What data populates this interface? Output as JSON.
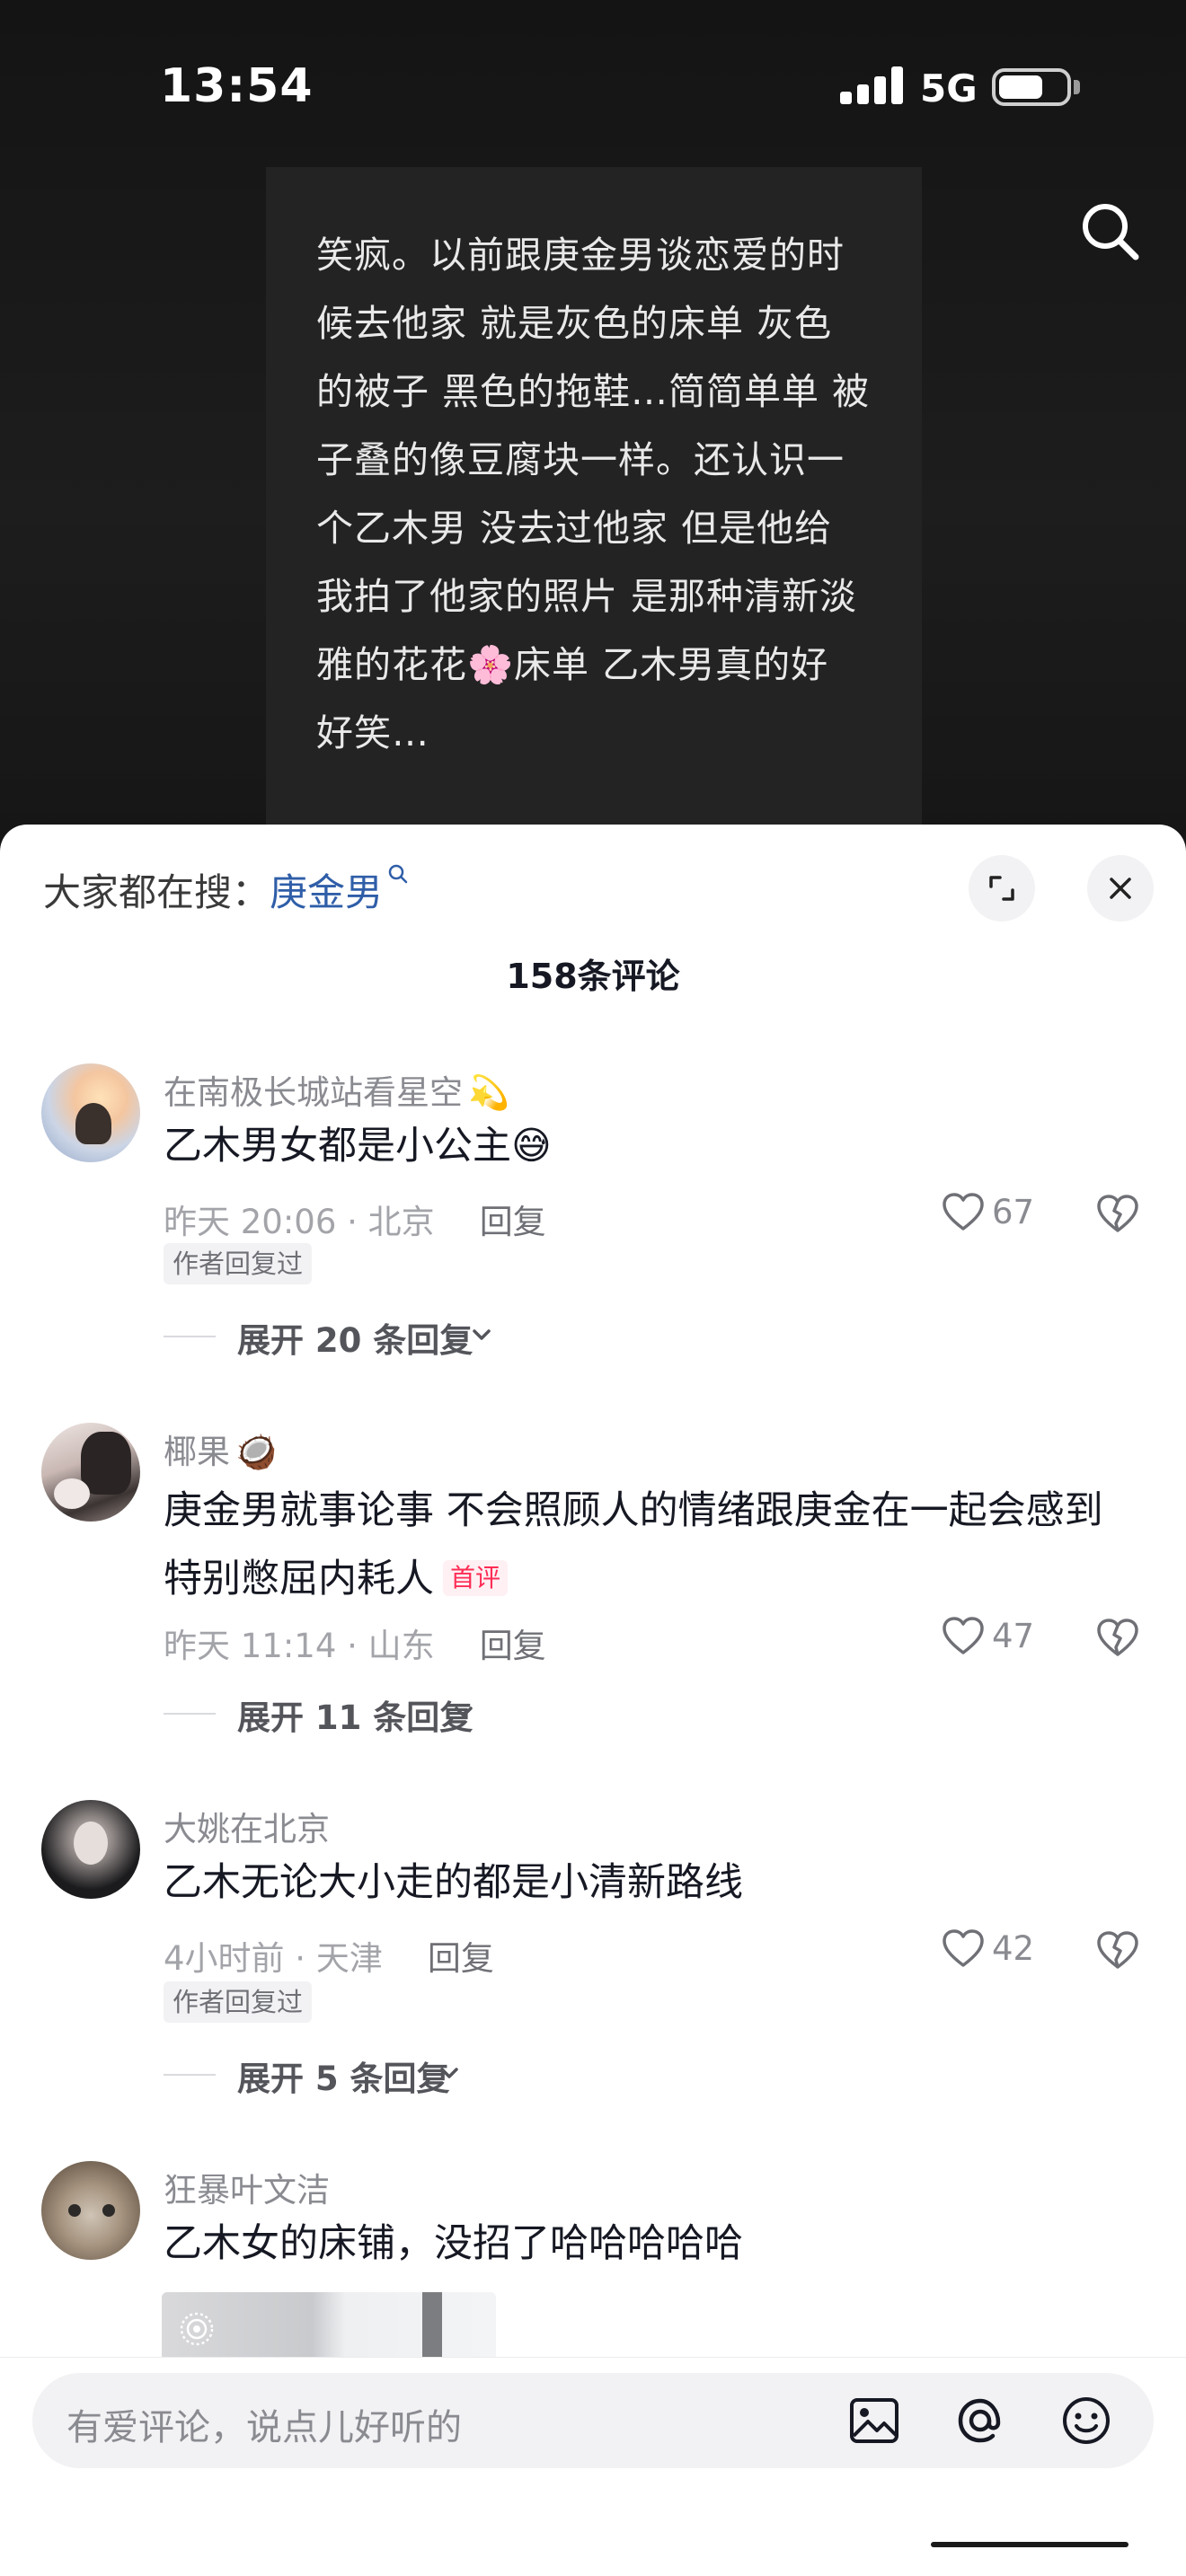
{
  "status_bar": {
    "time": "13:54",
    "network": "5G"
  },
  "post": {
    "text": "笑疯。以前跟庚金男谈恋爱的时\n候去他家 就是灰色的床单 灰色\n的被子 黑色的拖鞋…简简单单 被\n子叠的像豆腐块一样。还认识一\n个乙木男 没去过他家 但是他给\n我拍了他家的照片 是那种清新淡\n雅的花花🌸床单 乙木男真的好\n好笑…"
  },
  "panel": {
    "trend_prefix": "大家都在搜：",
    "trend_keyword": "庚金男",
    "comments_count": "158条评论"
  },
  "comments": [
    {
      "name": "在南极长城站看星空",
      "name_emoji": "💫",
      "text": "乙木男女都是小公主😅",
      "time_loc": "昨天 20:06 · 北京",
      "reply": "回复",
      "likes": "67",
      "badge": "作者回复过",
      "expand": "展开 20 条回复"
    },
    {
      "name": "椰果",
      "name_emoji": "🥥",
      "text": "庚金男就事论事 不会照顾人的情绪跟庚金在一起会感到特别憋屈内耗人",
      "first_tag": "首评",
      "time_loc": "昨天 11:14 · 山东",
      "reply": "回复",
      "likes": "47",
      "expand": "展开 11 条回复"
    },
    {
      "name": "大姚在北京",
      "text": "乙木无论大小走的都是小清新路线",
      "time_loc": "4小时前 · 天津",
      "reply": "回复",
      "likes": "42",
      "badge": "作者回复过",
      "expand": "展开 5 条回复"
    },
    {
      "name": "狂暴叶文洁",
      "text": "乙木女的床铺，没招了哈哈哈哈哈"
    }
  ],
  "input": {
    "placeholder": "有爱评论，说点儿好听的"
  },
  "icons": [
    "search-icon",
    "fullscreen-icon",
    "close-icon",
    "heart-icon",
    "broken-heart-icon",
    "chevron-down-icon",
    "image-icon",
    "at-icon",
    "emoji-icon",
    "live-photo-icon"
  ]
}
